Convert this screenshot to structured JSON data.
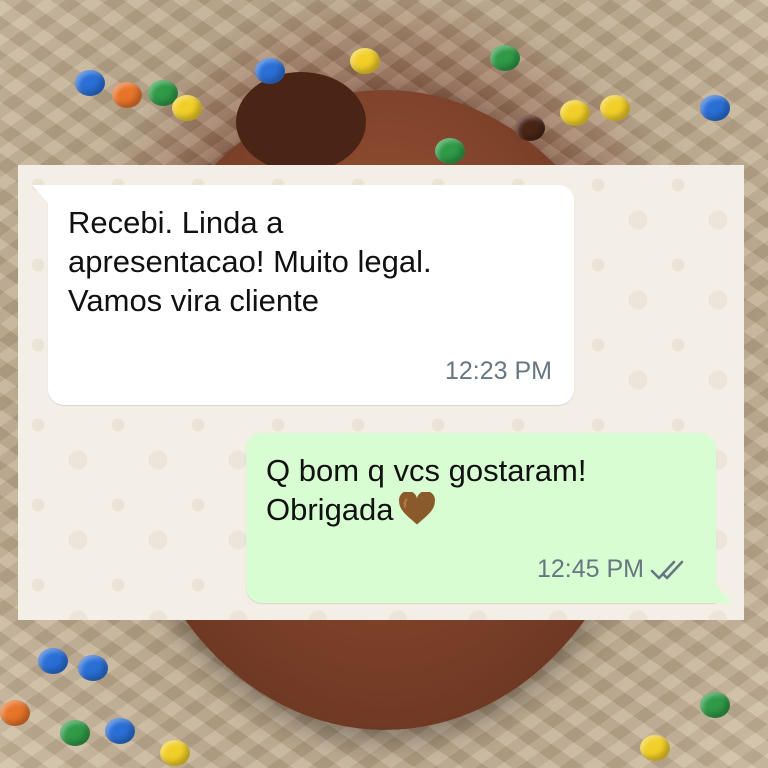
{
  "messages": {
    "incoming": {
      "text": "Recebi. Linda a\napresentacao! Muito legal.\nVamos vira cliente",
      "time": "12:23 PM"
    },
    "outgoing": {
      "text": "Q bom q vcs gostaram!\nObrigada",
      "emoji": "brown-heart",
      "time": "12:45 PM",
      "status": "read-double-check"
    }
  },
  "colors": {
    "incoming_bubble": "#ffffff",
    "outgoing_bubble": "#d8fdd2",
    "chat_background": "#f4efe6",
    "timestamp": "#667781",
    "read_ticks": "#667781",
    "heart": "#8b5a2b"
  }
}
